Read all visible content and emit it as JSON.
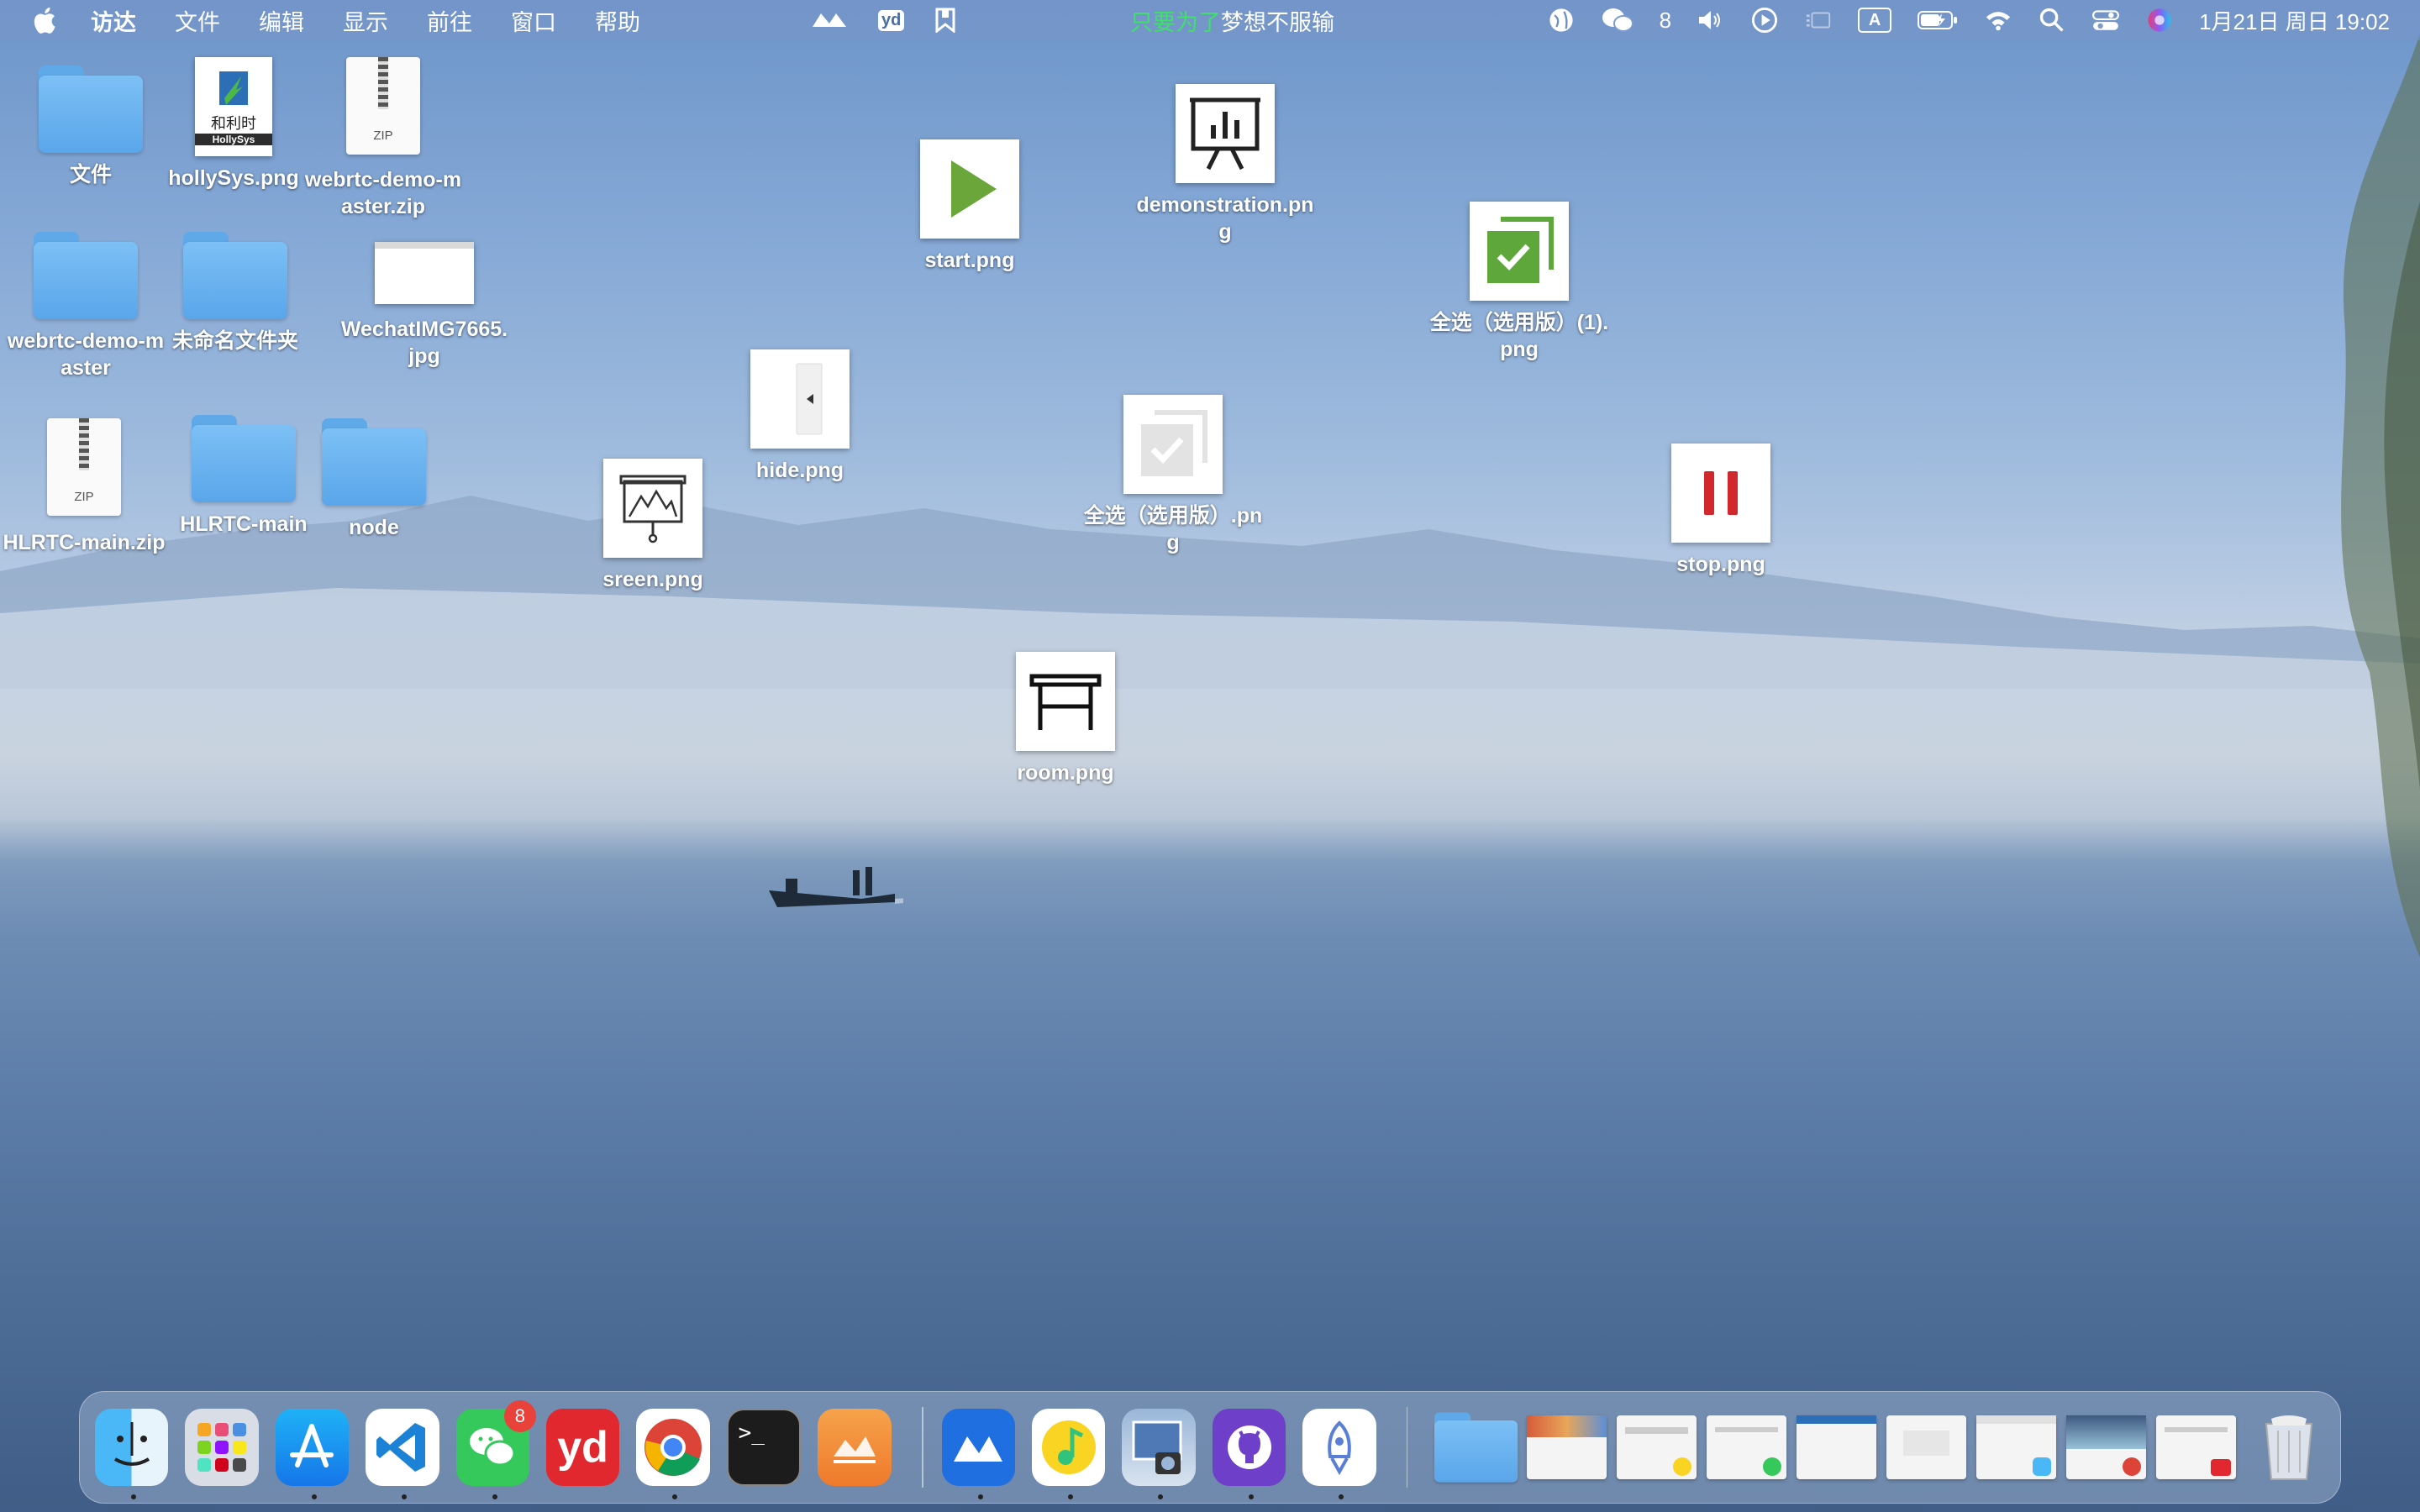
{
  "menubar": {
    "app_menus": [
      "访达",
      "文件",
      "编辑",
      "显示",
      "前往",
      "窗口",
      "帮助"
    ],
    "center_icons": [
      "maxhub-icon",
      "youdao-icon",
      "bookmark-icon"
    ],
    "youdao_text": "yd",
    "slogan_green": "只要为了",
    "slogan_rest": "梦想不服输",
    "wechat_count": "8",
    "input_method": "A",
    "datetime": "1月21日 周日  19:02"
  },
  "desktop": {
    "icons": [
      {
        "id": "wenjian",
        "label": "文件",
        "kind": "folder"
      },
      {
        "id": "hollysys",
        "label": "hollySys.png",
        "kind": "image"
      },
      {
        "id": "webrtc-zip",
        "label": "webrtc-demo-master.zip",
        "kind": "zip"
      },
      {
        "id": "webrtc-folder",
        "label": "webrtc-demo-master",
        "kind": "folder"
      },
      {
        "id": "unnamed-folder",
        "label": "未命名文件夹",
        "kind": "folder"
      },
      {
        "id": "wechatimg",
        "label": "WechatIMG7665.jpg",
        "kind": "image"
      },
      {
        "id": "hlrtc-zip",
        "label": "HLRTC-main.zip",
        "kind": "zip"
      },
      {
        "id": "hlrtc-folder",
        "label": "HLRTC-main",
        "kind": "folder"
      },
      {
        "id": "node-folder",
        "label": "node",
        "kind": "folder"
      },
      {
        "id": "sreen",
        "label": "sreen.png",
        "kind": "image"
      },
      {
        "id": "hide",
        "label": "hide.png",
        "kind": "image"
      },
      {
        "id": "start",
        "label": "start.png",
        "kind": "image"
      },
      {
        "id": "demonstration",
        "label": "demonstration.png",
        "kind": "image"
      },
      {
        "id": "selectall-gray",
        "label": "全选（选用版）.png",
        "kind": "image"
      },
      {
        "id": "selectall-green",
        "label": "全选（选用版）(1).png",
        "kind": "image"
      },
      {
        "id": "stop",
        "label": "stop.png",
        "kind": "image"
      },
      {
        "id": "room",
        "label": "room.png",
        "kind": "image"
      }
    ],
    "zip_text": "ZIP",
    "hollysys_brand": "HollySys"
  },
  "dock": {
    "apps": [
      "Finder",
      "Launchpad",
      "App Store",
      "Visual Studio Code",
      "WeChat",
      "Youdao Dictionary",
      "Google Chrome",
      "Terminal",
      "Infinity",
      "Maxhub",
      "QQ Music",
      "Preview",
      "GitHub Desktop",
      "Rocket",
      "Downloads"
    ],
    "wechat_badge": "8",
    "youdao_text": "yd",
    "terminal_text": ">_"
  },
  "colors": {
    "folder_blue": "#6cb6f2",
    "start_green": "#6aa63a",
    "stop_red": "#d0282c",
    "badge_red": "#e8423a",
    "slogan_green": "#3fe06a"
  }
}
